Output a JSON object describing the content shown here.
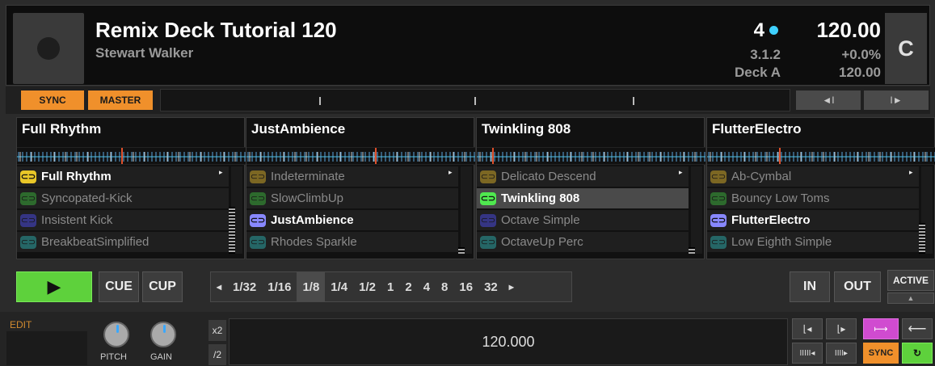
{
  "header": {
    "title": "Remix Deck Tutorial 120",
    "artist": "Stewart Walker",
    "beats": "4",
    "bpm": "120.00",
    "position": "3.1.2",
    "deck": "Deck A",
    "pitch": "+0.0%",
    "tempo": "120.00",
    "deck_letter": "C",
    "dot_color": "#3fd0ff"
  },
  "sync": {
    "sync_label": "SYNC",
    "master_label": "MASTER",
    "prev_icon": "◄I",
    "next_icon": "I►"
  },
  "slots": [
    {
      "title": "Full Rhythm",
      "cells": [
        {
          "label": "Full Rhythm",
          "color": "#e8c628"
        },
        {
          "label": "Syncopated-Kick",
          "color": "#3aa83a"
        },
        {
          "label": "Insistent Kick",
          "color": "#4848d8"
        },
        {
          "label": "BreakbeatSimplified",
          "color": "#2aa0a0"
        }
      ]
    },
    {
      "title": "JustAmbience",
      "cells": [
        {
          "label": "Indeterminate",
          "color": "#c8a228"
        },
        {
          "label": "SlowClimbUp",
          "color": "#3aa83a"
        },
        {
          "label": "JustAmbience",
          "color": "#8888ff"
        },
        {
          "label": "Rhodes Sparkle",
          "color": "#2aa0a0"
        }
      ]
    },
    {
      "title": "Twinkling 808",
      "cells": [
        {
          "label": "Delicato Descend",
          "color": "#c8a228"
        },
        {
          "label": "Twinkling 808",
          "color": "#4fe84f"
        },
        {
          "label": "Octave Simple",
          "color": "#4848d8"
        },
        {
          "label": "OctaveUp Perc",
          "color": "#2aa0a0"
        }
      ]
    },
    {
      "title": "FlutterElectro",
      "cells": [
        {
          "label": "Ab-Cymbal",
          "color": "#c8a228"
        },
        {
          "label": "Bouncy Low Toms",
          "color": "#3aa83a"
        },
        {
          "label": "FlutterElectro",
          "color": "#8888ff"
        },
        {
          "label": "Low Eighth Simple",
          "color": "#2aa0a0"
        }
      ]
    }
  ],
  "transport": {
    "play_icon": "▶",
    "cue": "CUE",
    "cup": "CUP",
    "loop_prev": "◂",
    "loop_next": "▸",
    "loop_sizes": [
      "1/32",
      "1/16",
      "1/8",
      "1/4",
      "1/2",
      "1",
      "2",
      "4",
      "8",
      "16",
      "32"
    ],
    "loop_active": "1/8",
    "in": "IN",
    "out": "OUT",
    "active": "ACTIVE"
  },
  "bottom": {
    "edit": "EDIT",
    "pitch": "PITCH",
    "gain": "GAIN",
    "x2": "x2",
    "half": "/2",
    "tempo_value": "120.000",
    "sync_small": "SYNC"
  }
}
